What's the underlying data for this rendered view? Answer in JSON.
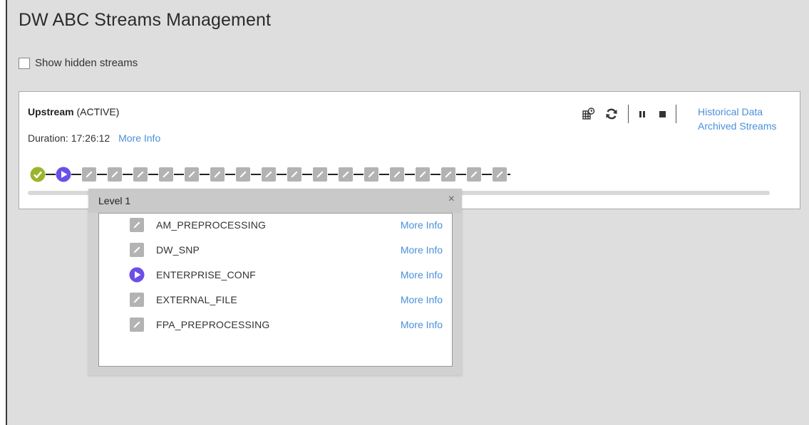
{
  "page": {
    "title": "DW ABC Streams Management",
    "show_hidden_label": "Show hidden streams",
    "show_hidden_checked": false
  },
  "stream": {
    "name": "Upstream",
    "status": "(ACTIVE)",
    "duration_label": "Duration: 17:26:12",
    "more_info": "More Info",
    "links": {
      "historical": "Historical Data",
      "archived": "Archived Streams"
    },
    "toolbar_icons": [
      "schedule-icon",
      "refresh-icon",
      "pause-icon",
      "stop-icon"
    ],
    "pipeline_states": [
      "completed",
      "running",
      "pending",
      "pending",
      "pending",
      "pending",
      "pending",
      "pending",
      "pending",
      "pending",
      "pending",
      "pending",
      "pending",
      "pending",
      "pending",
      "pending",
      "pending",
      "pending",
      "pending"
    ]
  },
  "popup": {
    "title": "Level 1",
    "close": "×",
    "jobs": [
      {
        "name": "AM_PREPROCESSING",
        "state": "pending",
        "more_info": "More Info"
      },
      {
        "name": "DW_SNP",
        "state": "pending",
        "more_info": "More Info"
      },
      {
        "name": "ENTERPRISE_CONF",
        "state": "running",
        "more_info": "More Info"
      },
      {
        "name": "EXTERNAL_FILE",
        "state": "pending",
        "more_info": "More Info"
      },
      {
        "name": "FPA_PREPROCESSING",
        "state": "pending",
        "more_info": "More Info"
      }
    ]
  },
  "colors": {
    "completed": "#9bb52b",
    "running": "#6c4ee8",
    "pending": "#b3b3b3",
    "link": "#4a90d9"
  }
}
